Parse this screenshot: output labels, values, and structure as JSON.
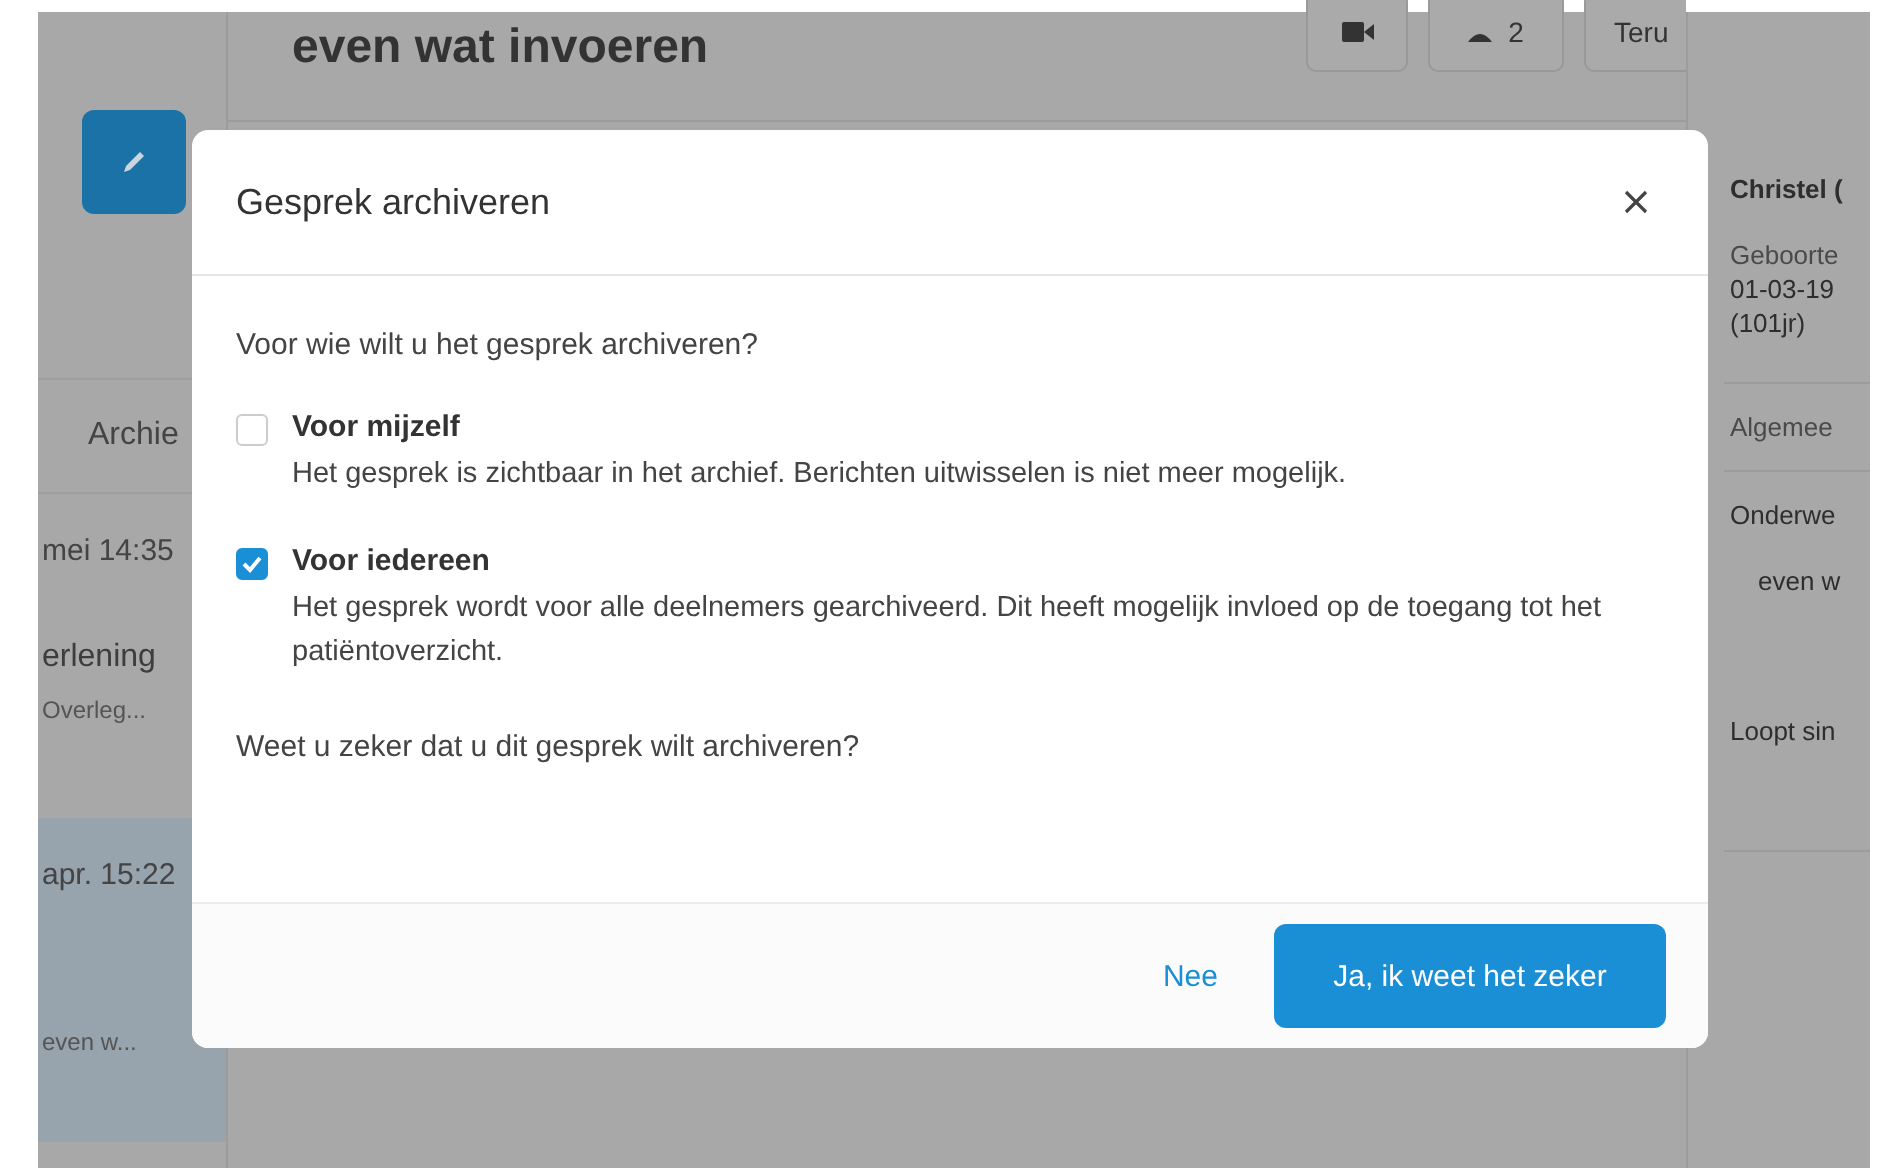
{
  "header": {
    "title": "even wat invoeren",
    "buttons": [
      {
        "kind": "video"
      },
      {
        "kind": "people",
        "label": "2"
      },
      {
        "kind": "text",
        "label": "Teru"
      }
    ]
  },
  "sidebar": {
    "tab": "Archie",
    "items": [
      {
        "time": "mei 14:35",
        "title": "erlening",
        "preview": "Overleg...",
        "selected": false
      },
      {
        "time": "apr. 15:22",
        "preview": "even w...",
        "selected": true
      }
    ]
  },
  "patient": {
    "name": "Christel (",
    "birth_label": "Geboorte",
    "birth_value": "01-03-19",
    "age": "(101jr)",
    "section": "Algemee",
    "subject_label": "Onderwe",
    "subject_value": "even w",
    "status": "Loopt sin"
  },
  "dialog": {
    "title": "Gesprek archiveren",
    "question": "Voor wie wilt u het gesprek archiveren?",
    "options": [
      {
        "label": "Voor mijzelf",
        "description": "Het gesprek is zichtbaar in het archief. Berichten uitwisselen is niet meer mogelijk.",
        "checked": false
      },
      {
        "label": "Voor iedereen",
        "description": "Het gesprek wordt voor alle deelnemers gearchiveerd. Dit heeft mogelijk invloed op de toegang tot het patiëntoverzicht.",
        "checked": true
      }
    ],
    "confirm_text": "Weet u zeker dat u dit gesprek wilt archiveren?",
    "cancel": "Nee",
    "ok": "Ja, ik weet het zeker"
  }
}
